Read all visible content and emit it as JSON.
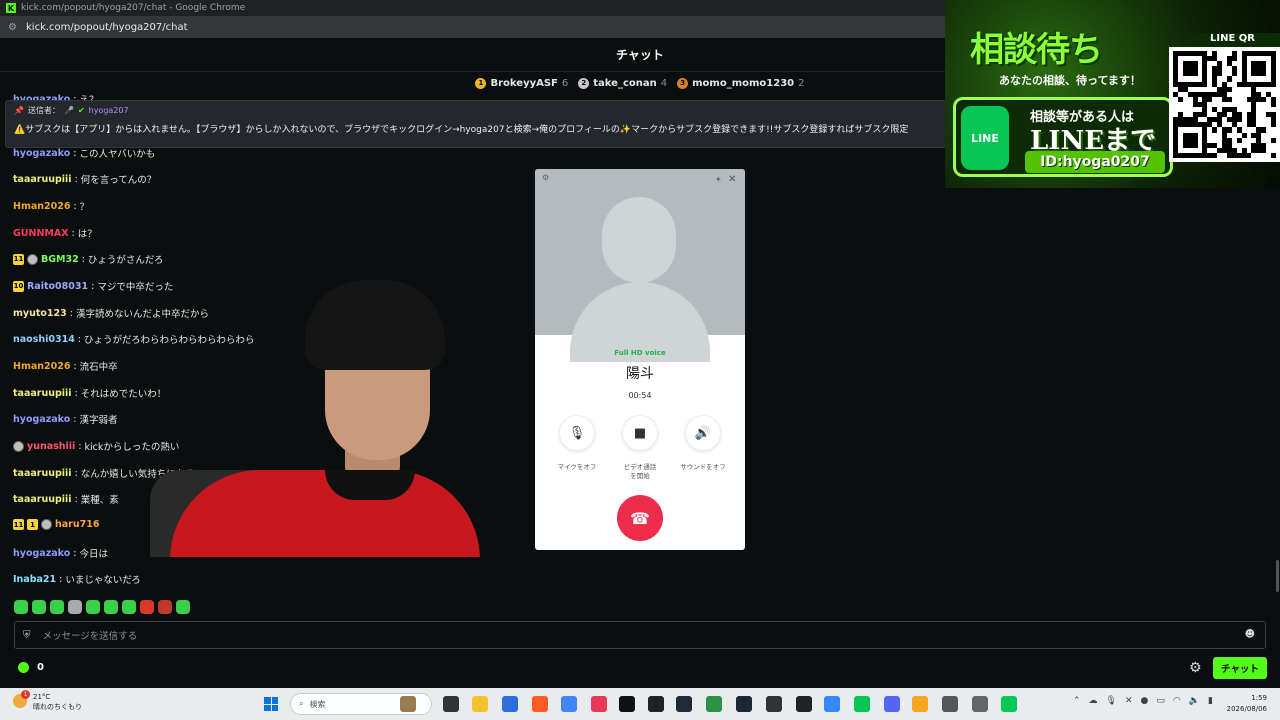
{
  "browser": {
    "window_title": "kick.com/popout/hyoga207/chat - Google Chrome",
    "url": "kick.com/popout/hyoga207/chat"
  },
  "chat": {
    "header": "チャット",
    "top_gifters": [
      {
        "rank": "1",
        "name": "BrokeyyASF",
        "count": "6",
        "color": "#f0b429"
      },
      {
        "rank": "2",
        "name": "take_conan",
        "count": "4",
        "color": "#c8c8c8"
      },
      {
        "rank": "3",
        "name": "momo_momo1230",
        "count": "2",
        "color": "#d9822b"
      }
    ],
    "partial_top": {
      "user": "hyogazako",
      "text": "え？"
    },
    "pinned": {
      "label": "送信者：",
      "sender": "hyoga207",
      "text": "⚠️サブスクは【アプリ】からは入れません。【ブラウザ】からしか入れないので、ブラウザでキックログイン→hyoga207と検索→俺のプロフィールの✨マークからサブスク登録できます!!サブスク登録すればサブスク限定"
    },
    "messages": [
      {
        "user": "hyogazako",
        "color": "#8c9cff",
        "text": "この人ヤバいかも",
        "badges": []
      },
      {
        "user": "taaaruupiii",
        "color": "#f0f07a",
        "text": "何を言ってんの？",
        "badges": []
      },
      {
        "user": "Hman2026",
        "color": "#f5a623",
        "text": "？",
        "badges": []
      },
      {
        "user": "GUNNMAX",
        "color": "#ff3b5c",
        "text": "は？",
        "badges": []
      },
      {
        "user": "BGM32",
        "color": "#7dff5a",
        "text": "ひょうがさんだろ",
        "badges": [
          "11",
          "circle"
        ]
      },
      {
        "user": "Raito08031",
        "color": "#9aa9ff",
        "text": "マジで中卒だった",
        "badges": [
          "10"
        ]
      },
      {
        "user": "myuto123",
        "color": "#f6e3a1",
        "text": "漢字読めないんだよ中卒だから",
        "badges": []
      },
      {
        "user": "naoshi0314",
        "color": "#8fd0ff",
        "text": "ひょうがだろわらわらわらわらわらわら",
        "badges": []
      },
      {
        "user": "Hman2026",
        "color": "#f5a623",
        "text": "流石中卒",
        "badges": []
      },
      {
        "user": "taaaruupiii",
        "color": "#f0f07a",
        "text": "それはめでたいわ！",
        "badges": []
      },
      {
        "user": "hyogazako",
        "color": "#8c9cff",
        "text": "漢字弱者",
        "badges": []
      },
      {
        "user": "yunashiii",
        "color": "#ff5470",
        "text": "kickからしったの熱い",
        "badges": [
          "circle"
        ]
      },
      {
        "user": "taaaruupiii",
        "color": "#f0f07a",
        "text": "なんか嬉しい気持ちになる",
        "badges": []
      },
      {
        "user": "taaaruupiii",
        "color": "#f0f07a",
        "text": "業種、素",
        "badges": []
      },
      {
        "user": "haru716",
        "color": "#ffa53b",
        "text": "",
        "badges": [
          "11",
          "1",
          "circle"
        ]
      },
      {
        "user": "hyogazako",
        "color": "#8c9cff",
        "text": "今日は",
        "badges": []
      },
      {
        "user": "Inaba21",
        "color": "#7fe3ff",
        "text": "いまじゃないだろ",
        "badges": []
      }
    ],
    "input_placeholder": "メッセージを送信する",
    "points": "0",
    "send_label": "チャット"
  },
  "call": {
    "quality": "Full HD voice",
    "callee": "陽斗",
    "duration": "00:54",
    "controls": [
      {
        "icon": "mic-icon",
        "glyph": "🎙",
        "label": "マイクをオフ"
      },
      {
        "icon": "video-icon",
        "glyph": "■",
        "label": "ビデオ通話を開始"
      },
      {
        "icon": "speaker-icon",
        "glyph": "🔊",
        "label": "サウンドをオフ"
      }
    ]
  },
  "ad": {
    "headline": "相談待ち",
    "subline": "あなたの相談、待ってます！",
    "line_icon_label": "LINE",
    "cta_line1": "相談等がある人は",
    "cta_line2": "LINEまで",
    "line_id": "ID:hyoga0207",
    "qr_label": "LINE QR"
  },
  "taskbar": {
    "temperature": "21°C",
    "weather": "晴れのちくもり",
    "weather_alert": "1",
    "search_placeholder": "検索",
    "time": "1:59",
    "date": "2026/08/06"
  },
  "colors": {
    "kick_green": "#53fc18",
    "line_green": "#06c755",
    "hangup_red": "#ec2c4a"
  }
}
